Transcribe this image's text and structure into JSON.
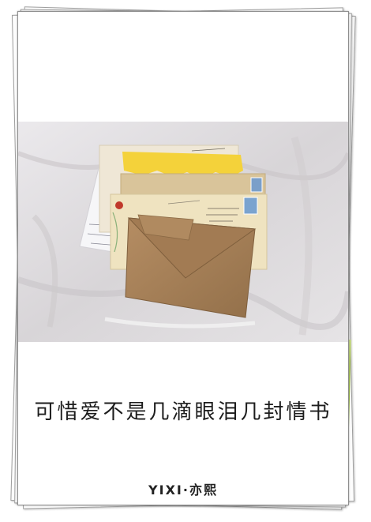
{
  "cover": {
    "title": "可惜爱不是几滴眼泪几封情书",
    "author": "YIXI·亦熙"
  },
  "photo": {
    "subject": "envelopes-on-sheets",
    "colors": {
      "fabric": "#dddadd",
      "kraft": "#a9825a",
      "envelope_cream": "#efe3c0",
      "yellow_paper": "#f4d23a",
      "stamp_blue": "#7a9fc9",
      "stamp_red": "#c0392b"
    }
  },
  "frame": {
    "accent_edge": "#a8c44e",
    "border": "#8f8f8f"
  }
}
